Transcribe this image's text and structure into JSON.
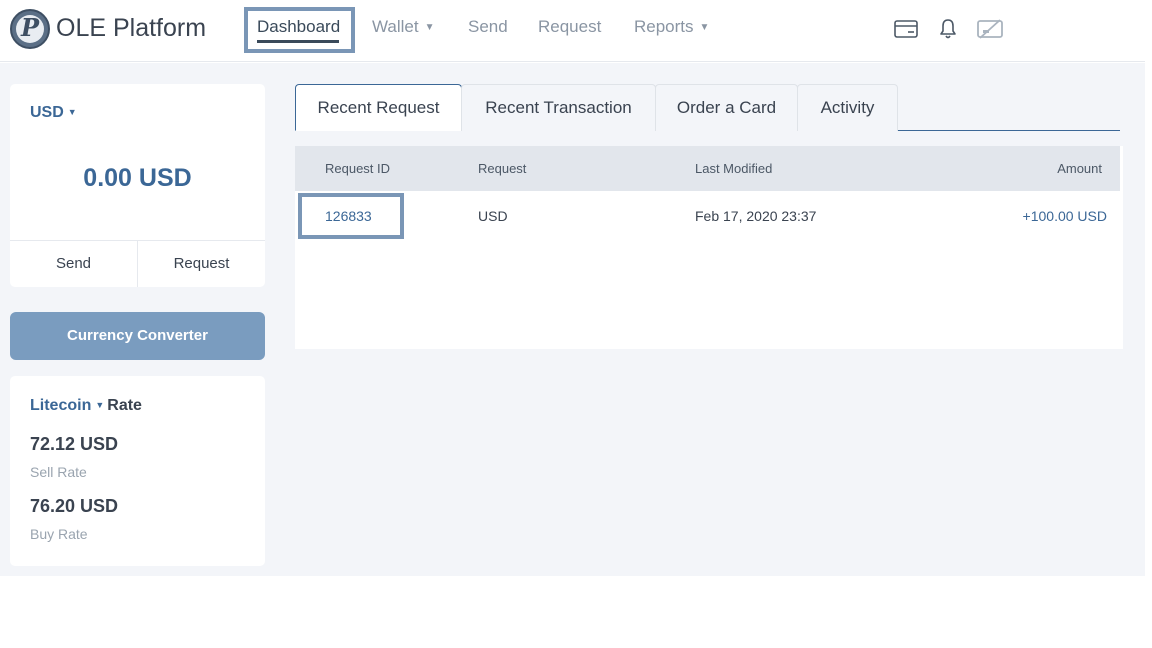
{
  "header": {
    "brand": "OLE Platform",
    "logo_letter": "P",
    "nav": {
      "dashboard": "Dashboard",
      "wallet": "Wallet",
      "send": "Send",
      "request": "Request",
      "reports": "Reports"
    },
    "icons": [
      "card-icon",
      "bell-icon",
      "disabled-card-icon"
    ]
  },
  "balance": {
    "currency": "USD",
    "amount": "0.00 USD",
    "send_label": "Send",
    "request_label": "Request"
  },
  "converter_label": "Currency Converter",
  "rate": {
    "coin": "Litecoin",
    "title_suffix": "Rate",
    "sell_value": "72.12 USD",
    "sell_label": "Sell Rate",
    "buy_value": "76.20 USD",
    "buy_label": "Buy Rate"
  },
  "tabs": [
    "Recent Request",
    "Recent Transaction",
    "Order a Card",
    "Activity"
  ],
  "table": {
    "headers": [
      "Request ID",
      "Request",
      "Last Modified",
      "Amount"
    ],
    "rows": [
      {
        "id": "126833",
        "request": "USD",
        "modified": "Feb 17, 2020 23:37",
        "amount": "+100.00 USD"
      }
    ]
  },
  "colors": {
    "accent": "#3b6796",
    "highlight_border": "#7a96b6",
    "converter_button": "#7a9cbf",
    "background": "#f3f5f9"
  }
}
